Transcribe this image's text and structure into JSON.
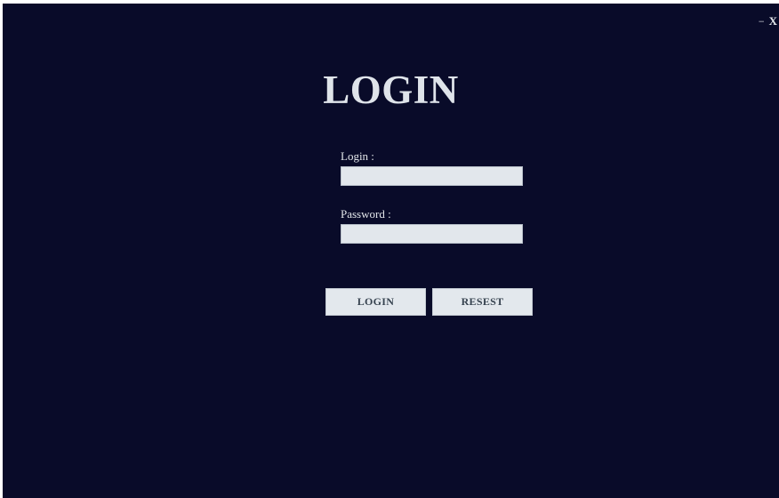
{
  "window": {
    "minimize_label": "−",
    "close_label": "X"
  },
  "header": {
    "title": "LOGIN"
  },
  "form": {
    "login_label": "Login :",
    "login_value": "",
    "password_label": "Password :",
    "password_value": "",
    "login_button": "LOGIN",
    "reset_button": "RESEST"
  },
  "colors": {
    "background": "#090b29",
    "input_background": "#e2e7ec",
    "button_background": "#e3e8ed",
    "button_text": "#374350"
  }
}
